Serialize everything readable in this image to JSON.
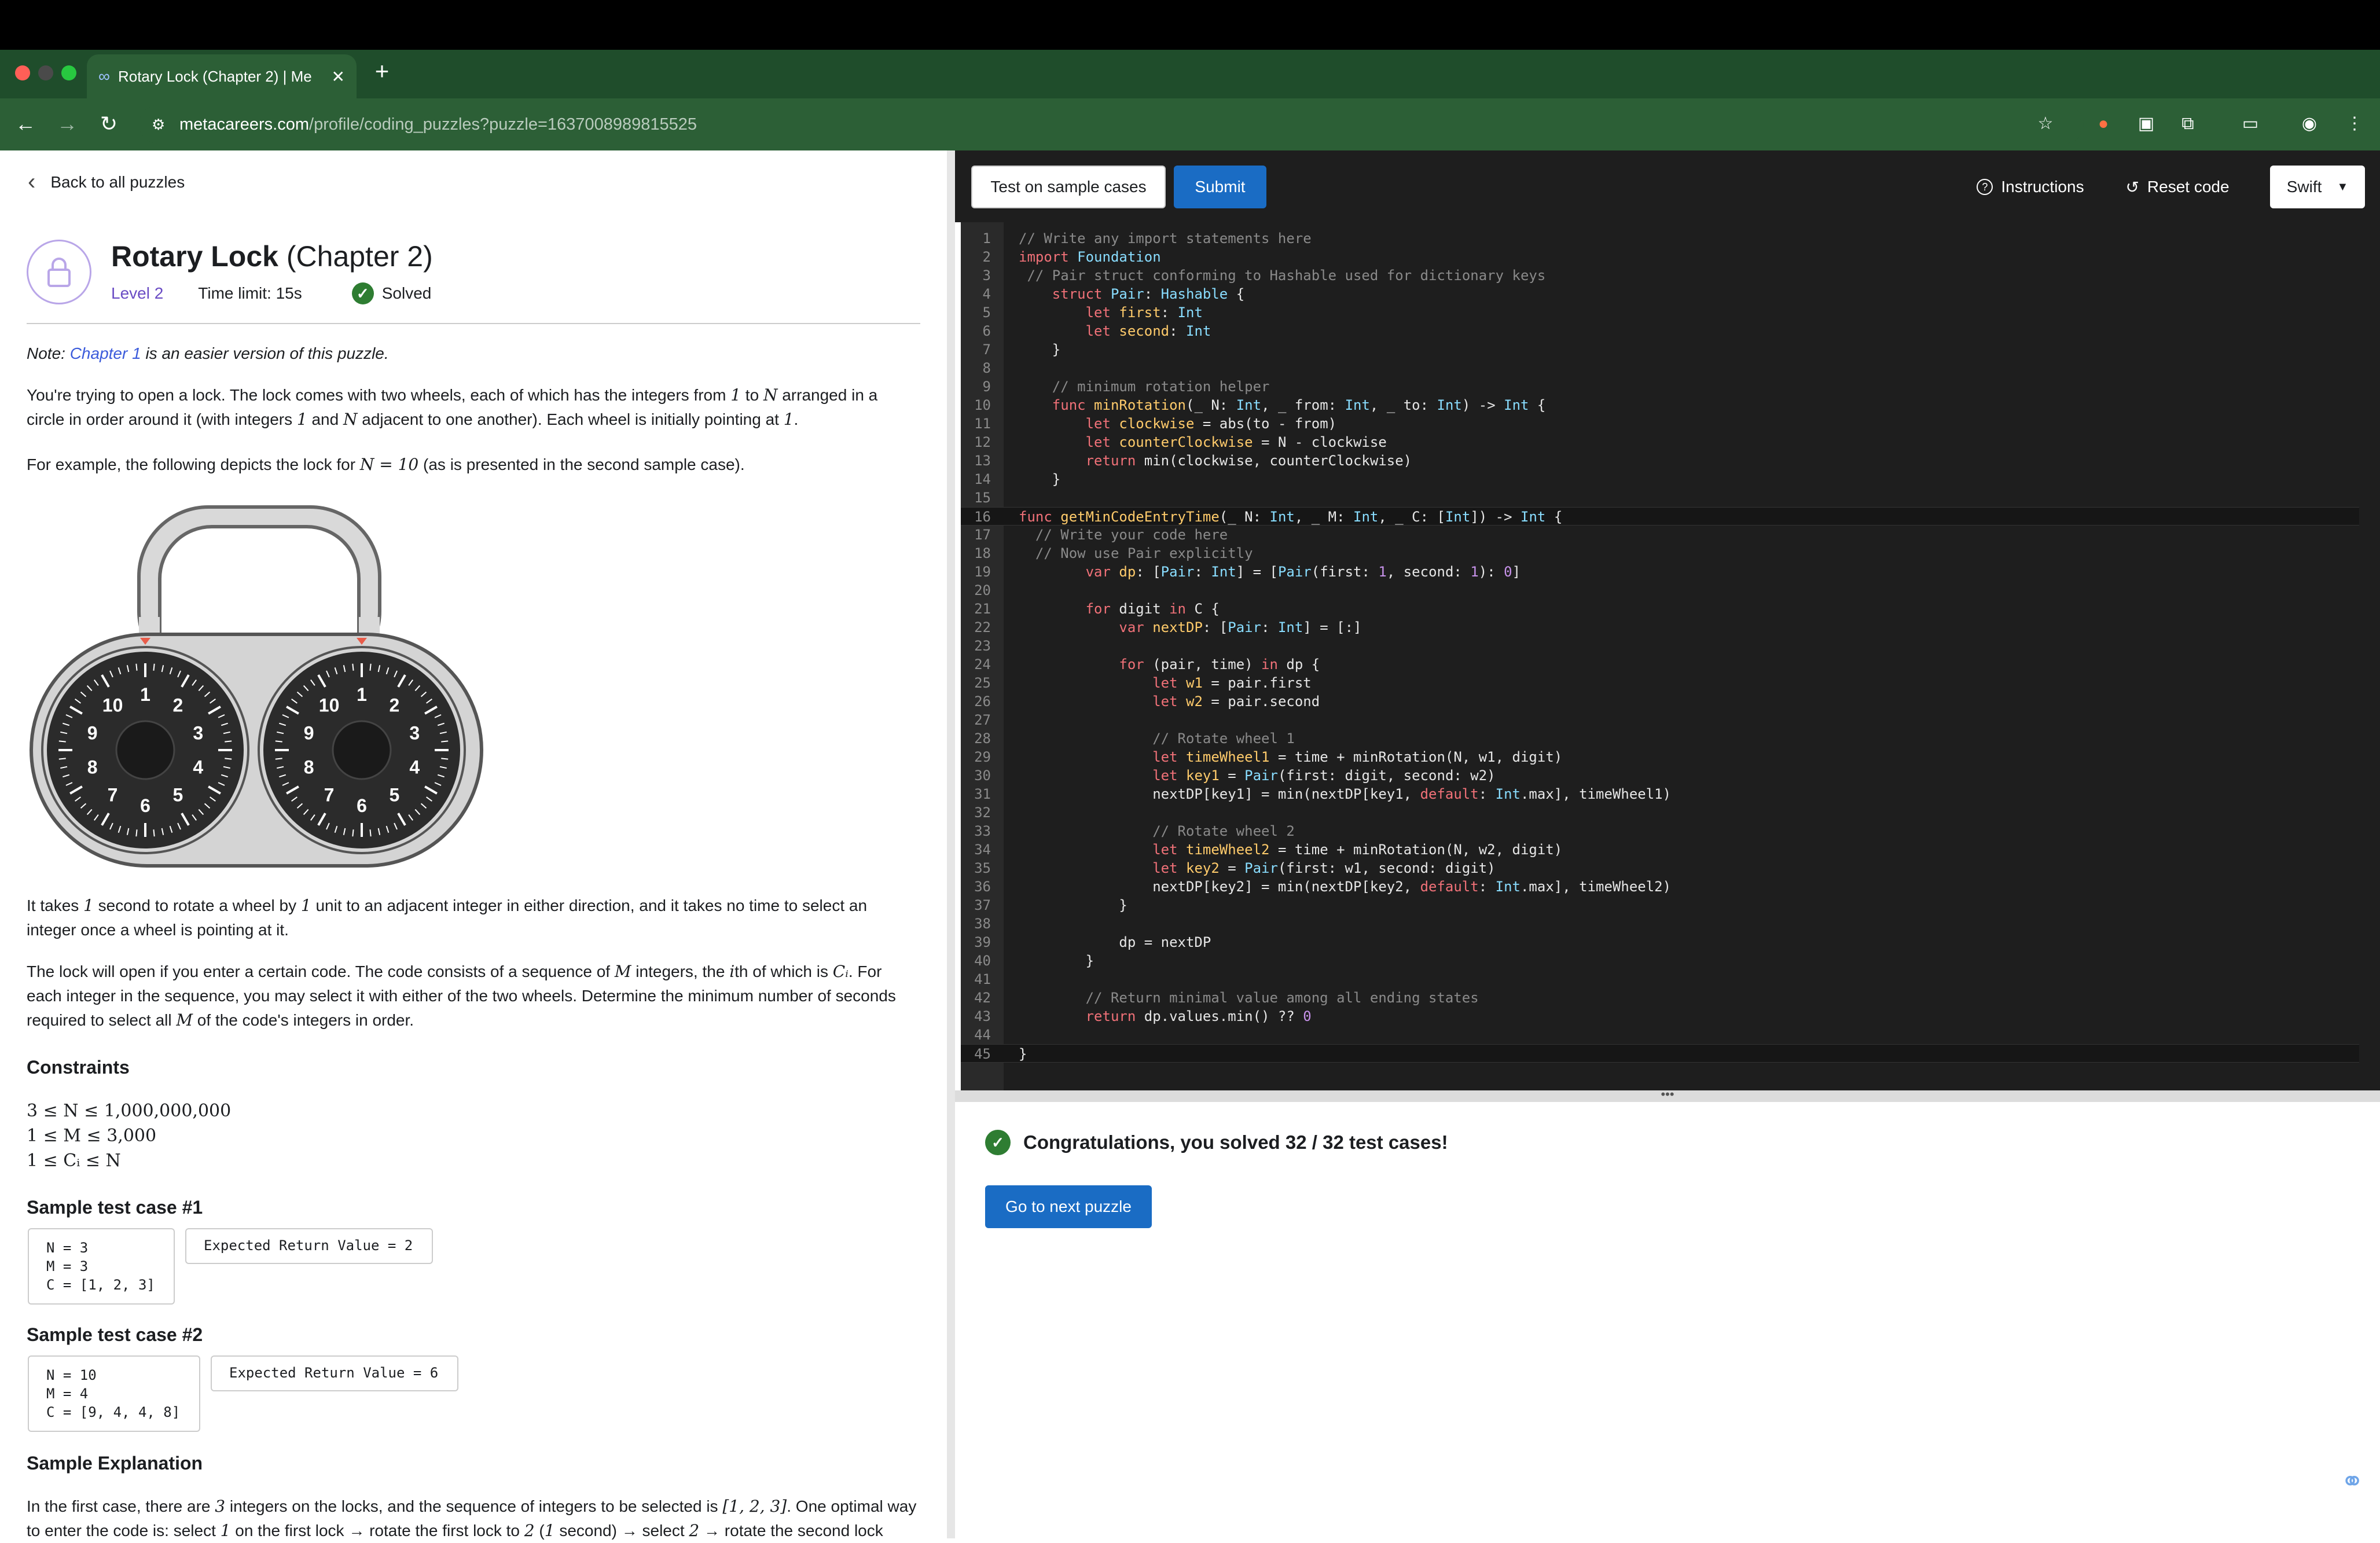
{
  "browser": {
    "tab_title": "Rotary Lock (Chapter 2) | Me",
    "url_host": "metacareers.com",
    "url_path": "/profile/coding_puzzles?puzzle=1637008989815525",
    "new_tab": "+"
  },
  "left": {
    "back_label": "Back to all puzzles",
    "title_main": "Rotary Lock",
    "title_chapter": "(Chapter 2)",
    "level": "Level 2",
    "time_limit": "Time limit: 15s",
    "solved": "Solved",
    "note_prefix": "Note: ",
    "note_link": "Chapter 1",
    "note_suffix": " is an easier version of this puzzle.",
    "p1_a": "You're trying to open a lock. The lock comes with two wheels, each of which has the integers from ",
    "p1_m1": "1",
    "p1_b": " to ",
    "p1_m2": "N",
    "p1_c": " arranged in a circle in order around it (with integers ",
    "p1_m3": "1",
    "p1_d": " and ",
    "p1_m4": "N",
    "p1_e": " adjacent to one another). Each wheel is initially pointing at ",
    "p1_m5": "1",
    "p1_f": ".",
    "p2_a": "For example, the following depicts the lock for ",
    "p2_m": "N = 10",
    "p2_b": " (as is presented in the second sample case).",
    "p3_a": "It takes ",
    "p3_m1": "1",
    "p3_b": " second to rotate a wheel by ",
    "p3_m2": "1",
    "p3_c": " unit to an adjacent integer in either direction, and it takes no time to select an integer once a wheel is pointing at it.",
    "p4_a": "The lock will open if you enter a certain code. The code consists of a sequence of ",
    "p4_m1": "M",
    "p4_b": " integers, the ",
    "p4_m2": "i",
    "p4_c": "th of which is ",
    "p4_m3": "Cᵢ",
    "p4_d": ". For each integer in the sequence, you may select it with either of the two wheels. Determine the minimum number of seconds required to select all ",
    "p4_m4": "M",
    "p4_e": " of the code's integers in order.",
    "constraints_title": "Constraints",
    "constraints": [
      "3 ≤ N ≤ 1,000,000,000",
      "1 ≤ M ≤ 3,000",
      "1 ≤ Cᵢ ≤ N"
    ],
    "sample1_title": "Sample test case #1",
    "sample1_input": "N = 3\nM = 3\nC = [1, 2, 3]",
    "sample1_expected": "Expected Return Value = 2",
    "sample2_title": "Sample test case #2",
    "sample2_input": "N = 10\nM = 4\nC = [9, 4, 4, 8]",
    "sample2_expected": "Expected Return Value = 6",
    "explanation_title": "Sample Explanation",
    "exp_a": "In the first case, there are ",
    "exp_m1": "3",
    "exp_b": " integers on the locks, and the sequence of integers to be selected is ",
    "exp_m2": "[1, 2, 3]",
    "exp_c": ". One optimal way to enter the code is: select ",
    "exp_m3": "1",
    "exp_d": " on the first lock → rotate the first lock to ",
    "exp_m4": "2",
    "exp_e": " (",
    "exp_m5": "1",
    "exp_f": " second) → select ",
    "exp_m6": "2",
    "exp_g": " → rotate the second lock",
    "dial_numbers": [
      "10",
      "1",
      "2",
      "9",
      "3",
      "8",
      "4",
      "7",
      "6",
      "5"
    ]
  },
  "right": {
    "test_button": "Test on sample cases",
    "submit_button": "Submit",
    "instructions": "Instructions",
    "reset_code": "Reset code",
    "language": "Swift",
    "congrats": "Congratulations, you solved 32 / 32 test cases!",
    "next_button": "Go to next puzzle",
    "resize_handle": "•••"
  },
  "code_lines": [
    "// Write any import statements here",
    "import Foundation",
    " // Pair struct conforming to Hashable used for dictionary keys",
    "    struct Pair: Hashable {",
    "        let first: Int",
    "        let second: Int",
    "    }",
    "",
    "    // minimum rotation helper",
    "    func minRotation(_ N: Int, _ from: Int, _ to: Int) -> Int {",
    "        let clockwise = abs(to - from)",
    "        let counterClockwise = N - clockwise",
    "        return min(clockwise, counterClockwise)",
    "    }",
    "",
    "func getMinCodeEntryTime(_ N: Int, _ M: Int, _ C: [Int]) -> Int {",
    "  // Write your code here",
    "  // Now use Pair explicitly",
    "        var dp: [Pair: Int] = [Pair(first: 1, second: 1): 0]",
    "",
    "        for digit in C {",
    "            var nextDP: [Pair: Int] = [:]",
    "",
    "            for (pair, time) in dp {",
    "                let w1 = pair.first",
    "                let w2 = pair.second",
    "",
    "                // Rotate wheel 1",
    "                let timeWheel1 = time + minRotation(N, w1, digit)",
    "                let key1 = Pair(first: digit, second: w2)",
    "                nextDP[key1] = min(nextDP[key1, default: Int.max], timeWheel1)",
    "",
    "                // Rotate wheel 2",
    "                let timeWheel2 = time + minRotation(N, w2, digit)",
    "                let key2 = Pair(first: w1, second: digit)",
    "                nextDP[key2] = min(nextDP[key2, default: Int.max], timeWheel2)",
    "            }",
    "",
    "            dp = nextDP",
    "        }",
    "",
    "        // Return minimal value among all ending states",
    "        return dp.values.min() ?? 0",
    "",
    "}"
  ],
  "colors": {
    "accent": "#1a6cc4",
    "chrome": "#2c5f36",
    "success": "#2e7d32",
    "editor_bg": "#1e1e1e"
  }
}
